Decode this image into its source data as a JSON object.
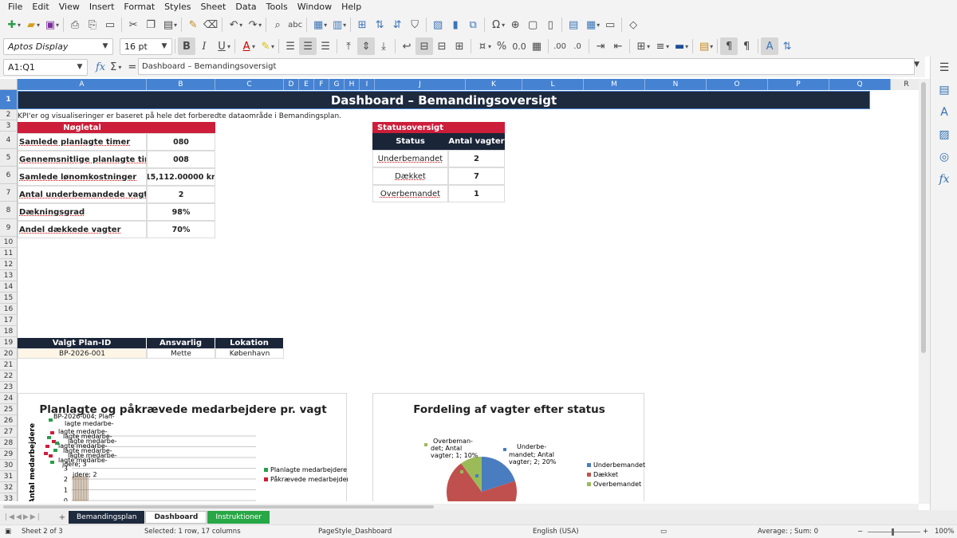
{
  "menu": [
    "File",
    "Edit",
    "View",
    "Insert",
    "Format",
    "Styles",
    "Sheet",
    "Data",
    "Tools",
    "Window",
    "Help"
  ],
  "toolbar": {
    "font_name": "Aptos Display",
    "font_size": "16 pt"
  },
  "formula": {
    "name_box": "A1:Q1",
    "content": "Dashboard – Bemandingsoversigt"
  },
  "columns": [
    "A",
    "B",
    "C",
    "D",
    "E",
    "F",
    "G",
    "H",
    "I",
    "J",
    "K",
    "L",
    "M",
    "N",
    "O",
    "P",
    "Q",
    "R"
  ],
  "rows": [
    "1",
    "2",
    "3",
    "4",
    "5",
    "6",
    "7",
    "8",
    "9",
    "10",
    "11",
    "12",
    "13",
    "14",
    "15",
    "16",
    "17",
    "18",
    "19",
    "20",
    "21",
    "22",
    "23",
    "24",
    "25",
    "26",
    "27",
    "28",
    "29",
    "30",
    "31",
    "32",
    "33"
  ],
  "colors": {
    "title_bg": "#1e2a3e",
    "red_header": "#cc1e3a",
    "dark_header": "#1b2538",
    "selection": "#4682d2",
    "tab_green": "#27a745"
  },
  "sheet": {
    "title": "Dashboard – Bemandingsoversigt",
    "note": "KPI'er og visualiseringer er baseret på hele det forberedte dataområde i Bemandingsplan.",
    "kpi_header": "Nøgletal",
    "kpis": [
      {
        "label": "Samlede planlagte timer",
        "value": "080"
      },
      {
        "label": "Gennemsnitlige planlagte timer pr. vagt",
        "value": "008"
      },
      {
        "label": "Samlede lønomkostninger",
        "value": "15,112.00000 kr."
      },
      {
        "label": "Antal underbemandede vagter",
        "value": "2"
      },
      {
        "label": "Dækningsgrad",
        "value": "98%"
      },
      {
        "label": "Andel dækkede vagter",
        "value": "70%"
      }
    ],
    "status_title": "Statusoversigt",
    "status_head": [
      "Status",
      "Antal vagter"
    ],
    "status_rows": [
      {
        "status": "Underbemandet",
        "count": "2"
      },
      {
        "status": "Dækket",
        "count": "7"
      },
      {
        "status": "Overbemandet",
        "count": "1"
      }
    ],
    "plan_head": [
      "Valgt Plan-ID",
      "Ansvarlig",
      "Lokation"
    ],
    "plan_row": [
      "BP-2026-001",
      "Mette",
      "København"
    ]
  },
  "chart1": {
    "title": "Planlagte og påkrævede medarbejdere pr. vagt",
    "ylabel": "Antal medarbejdere",
    "yticks": [
      "0",
      "1",
      "2",
      "3"
    ],
    "legend": [
      "Planlagte medarbejdere",
      "Påkrævede medarbejdere"
    ],
    "labels": [
      "BP-2026-004; Plan-",
      "lagte medarbe-",
      "jdere; 3",
      "jdere; 2"
    ],
    "colors": [
      "#2a9d4b",
      "#cc1e3a"
    ]
  },
  "chart_data": {
    "type": "pie",
    "title": "Fordeling af vagter efter status",
    "categories": [
      "Underbemandet",
      "Dækket",
      "Overbemandet"
    ],
    "values": [
      2,
      7,
      1
    ],
    "colors": [
      "#4a7cc0",
      "#c0504d",
      "#9bbb59"
    ],
    "labels": [
      "Underbe-",
      "mandet; Antal",
      "vagter; 2; 20%",
      "Overbeman-",
      "det; Antal",
      "vagter; 1; 10%"
    ],
    "legend": "right"
  },
  "tabs": [
    {
      "label": "Bemandingsplan",
      "bg": "#1e2a3e",
      "fg": "#ffffff"
    },
    {
      "label": "Dashboard",
      "bg": "#ffffff",
      "fg": "#222222"
    },
    {
      "label": "Instruktioner",
      "bg": "#27a745",
      "fg": "#ffffff"
    }
  ],
  "status": {
    "sheet": "Sheet 2 of 3",
    "selection": "Selected: 1 row, 17 columns",
    "pagestyle": "PageStyle_Dashboard",
    "language": "English (USA)",
    "summary": "Average: ; Sum: 0",
    "zoom": "100%"
  }
}
